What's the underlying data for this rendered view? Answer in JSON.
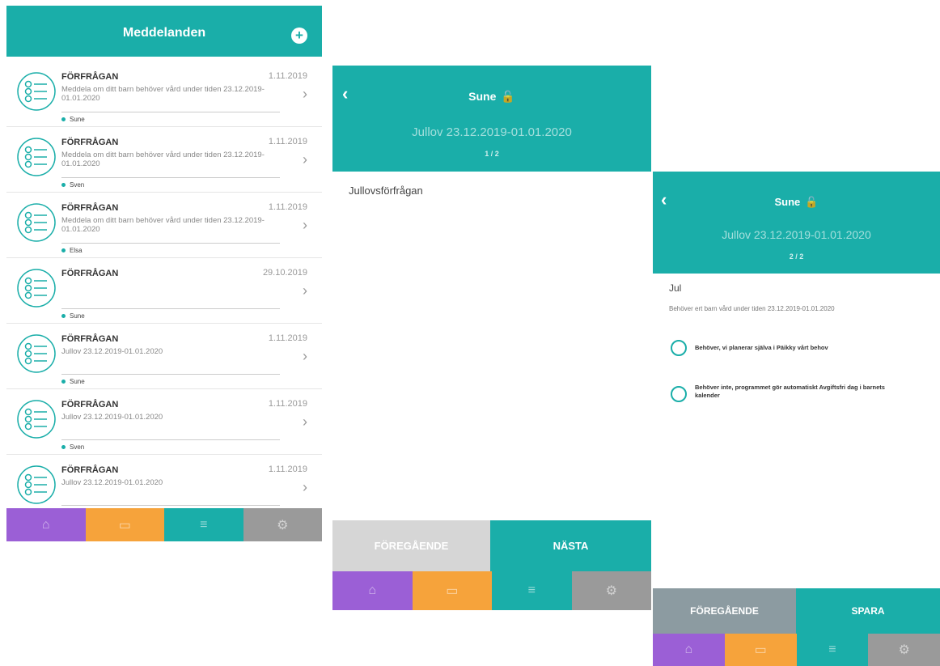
{
  "screen1": {
    "title": "Meddelanden",
    "add_icon": "plus-icon",
    "messages": [
      {
        "type": "FÖRFRÅGAN",
        "date": "1.11.2019",
        "text": "Meddela om ditt barn behöver vård under tiden 23.12.2019-01.01.2020",
        "child": "Sune"
      },
      {
        "type": "FÖRFRÅGAN",
        "date": "1.11.2019",
        "text": "Meddela om ditt barn behöver vård under tiden 23.12.2019-01.01.2020",
        "child": "Sven"
      },
      {
        "type": "FÖRFRÅGAN",
        "date": "1.11.2019",
        "text": "Meddela om ditt barn behöver vård under tiden 23.12.2019-01.01.2020",
        "child": "Elsa"
      },
      {
        "type": "FÖRFRÅGAN",
        "date": "29.10.2019",
        "text": "",
        "child": "Sune"
      },
      {
        "type": "FÖRFRÅGAN",
        "date": "1.11.2019",
        "text": "Jullov 23.12.2019-01.01.2020",
        "child": "Sune"
      },
      {
        "type": "FÖRFRÅGAN",
        "date": "1.11.2019",
        "text": "Jullov 23.12.2019-01.01.2020",
        "child": "Sven"
      },
      {
        "type": "FÖRFRÅGAN",
        "date": "1.11.2019",
        "text": "Jullov 23.12.2019-01.01.2020",
        "child": ""
      }
    ]
  },
  "screen2": {
    "name": "Sune",
    "subtitle": "Jullov 23.12.2019-01.01.2020",
    "page": "1 / 2",
    "body_text": "Jullovsförfrågan",
    "prev_label": "FÖREGÅENDE",
    "next_label": "NÄSTA"
  },
  "screen3": {
    "name": "Sune",
    "subtitle": "Jullov 23.12.2019-01.01.2020",
    "page": "2 / 2",
    "heading": "Jul",
    "question": "Behöver ert barn vård under tiden 23.12.2019-01.01.2020",
    "option1": "Behöver, vi planerar själva i Päikky vårt behov",
    "option2": "Behöver inte, programmet gör automatiskt Avgiftsfri dag i barnets kalender",
    "prev_label": "FÖREGÅENDE",
    "save_label": "SPARA"
  },
  "tabbar_icons": [
    "home-icon",
    "calendar-icon",
    "messages-icon",
    "settings-icon"
  ],
  "colors": {
    "teal": "#1aaea9",
    "purple": "#9b5fd6",
    "orange": "#f6a33b",
    "grey": "#9a9a9a"
  }
}
